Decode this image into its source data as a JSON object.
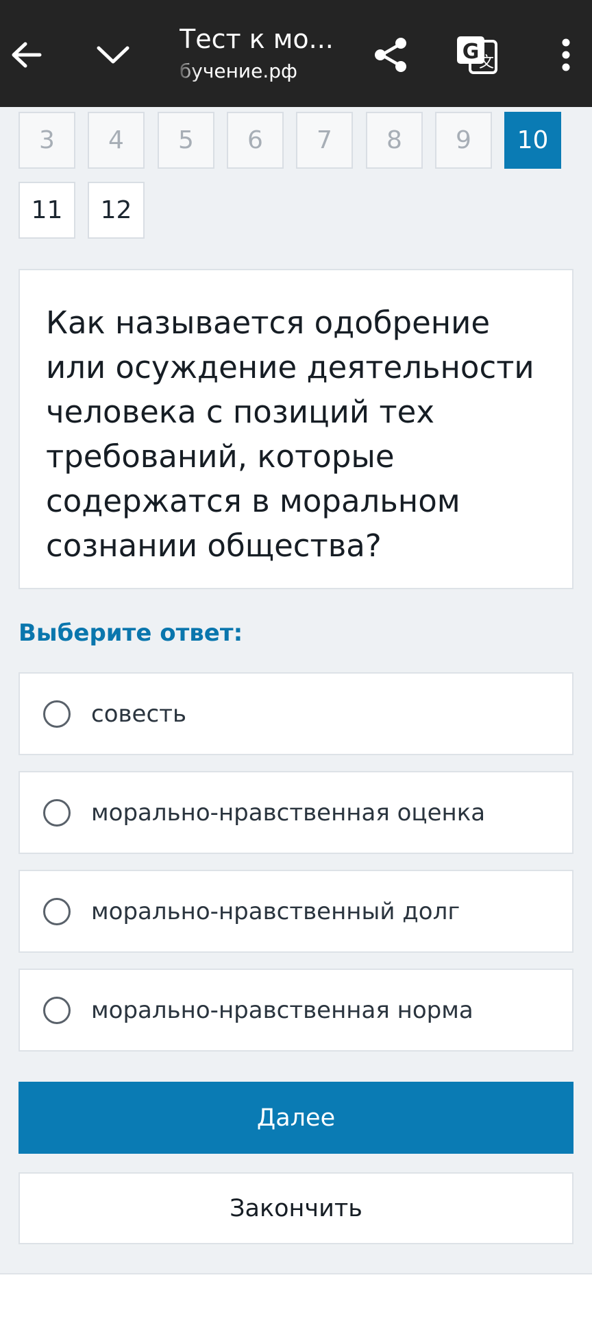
{
  "topbar": {
    "title": "Тест к мо...",
    "url": "бучение.рф",
    "icons": [
      "back-arrow-icon",
      "chevron-down-icon",
      "share-icon",
      "translate-icon",
      "more-vertical-icon"
    ]
  },
  "question_nav": {
    "row1": [
      "3",
      "4",
      "5",
      "6",
      "7",
      "8",
      "9",
      "10"
    ],
    "row2": [
      "11",
      "12"
    ],
    "active": "10"
  },
  "question": {
    "text": "Как называется одобрение или осуждение деятельности человека с позиций тех требований, которые содержатся в моральном сознании общества?"
  },
  "answer_prompt": "Выберите ответ:",
  "options": [
    "совесть",
    "морально-нравственная оценка",
    "морально-нравственный долг",
    "морально-нравственная норма"
  ],
  "buttons": {
    "next": "Далее",
    "finish": "Закончить"
  },
  "colors": {
    "accent": "#0a7bb4",
    "topbar": "#242424",
    "background": "#eef1f4"
  }
}
